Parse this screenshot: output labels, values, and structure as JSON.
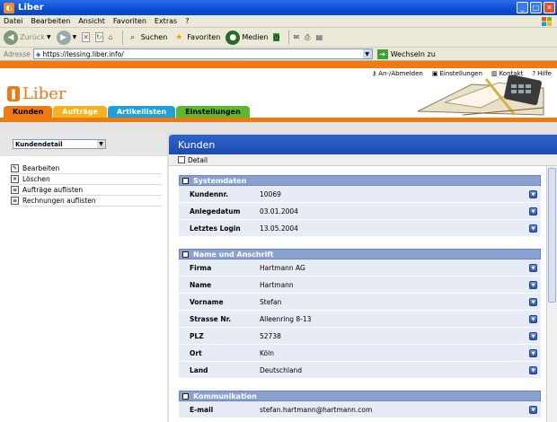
{
  "window": {
    "title": "Liber",
    "menu": [
      "Datei",
      "Bearbeiten",
      "Ansicht",
      "Favoriten",
      "Extras",
      "?"
    ]
  },
  "toolbar": {
    "back_label": "Zurück",
    "search_label": "Suchen",
    "favorites_label": "Favoriten",
    "media_label": "Medien"
  },
  "address": {
    "label": "Adresse",
    "url": "https://lessing.liber.info/",
    "go_label": "Wechseln zu"
  },
  "app": {
    "logo_text": "Liber",
    "top_links": [
      {
        "label": "An-/Abmelden",
        "icon": "key-icon"
      },
      {
        "label": "Einstellungen",
        "icon": "settings-icon"
      },
      {
        "label": "Kontakt",
        "icon": "contact-icon"
      },
      {
        "label": "Hilfe",
        "icon": "help-icon"
      }
    ],
    "tabs": [
      {
        "label": "Kunden",
        "bg": "#f07a12",
        "color": "#000000"
      },
      {
        "label": "Aufträge",
        "bg": "#f4b21c",
        "color": "#ffffff"
      },
      {
        "label": "Artikellisten",
        "bg": "#1ea0d8",
        "color": "#ffffff"
      },
      {
        "label": "Einstellungen",
        "bg": "#5cb82e",
        "color": "#000000"
      }
    ]
  },
  "left": {
    "select_value": "Kundendetail",
    "actions": [
      "Bearbeiten",
      "Löschen",
      "Aufträge auflisten",
      "Rechnungen auflisten"
    ]
  },
  "main": {
    "title": "Kunden",
    "detail_label": "Detail",
    "sections": [
      {
        "title": "Systemdaten",
        "rows": [
          {
            "key": "Kundennr.",
            "value": "10069"
          },
          {
            "key": "Anlegedatum",
            "value": "03.01.2004"
          },
          {
            "key": "Letztes Login",
            "value": "13.05.2004"
          }
        ]
      },
      {
        "title": "Name und Anschrift",
        "rows": [
          {
            "key": "Firma",
            "value": "Hartmann AG"
          },
          {
            "key": "Name",
            "value": "Hartmann"
          },
          {
            "key": "Vorname",
            "value": "Stefan"
          },
          {
            "key": "Strasse Nr.",
            "value": "Alleenring 8-13"
          },
          {
            "key": "PLZ",
            "value": "52738"
          },
          {
            "key": "Ort",
            "value": "Köln"
          },
          {
            "key": "Land",
            "value": "Deutschland"
          }
        ]
      },
      {
        "title": "Kommunikation",
        "rows": [
          {
            "key": "E-mail",
            "value": "stefan.hartmann@hartmann.com"
          }
        ]
      }
    ]
  }
}
